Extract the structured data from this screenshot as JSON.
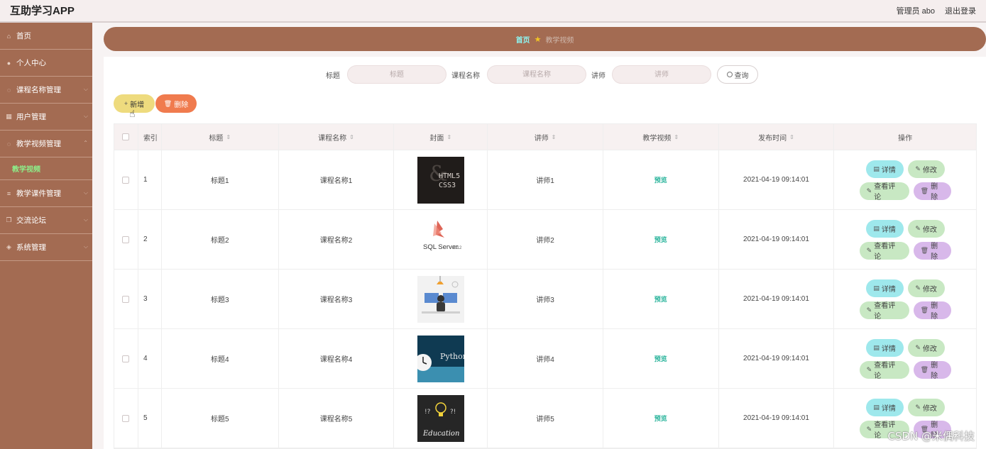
{
  "app": {
    "title": "互助学习APP",
    "admin": "管理员 abo",
    "logout": "退出登录"
  },
  "sidebar": {
    "items": [
      {
        "label": "首页",
        "icon": "home-icon"
      },
      {
        "label": "个人中心",
        "icon": "user-icon"
      },
      {
        "label": "课程名称管理",
        "icon": "grid-icon"
      },
      {
        "label": "用户管理",
        "icon": "grid-icon"
      },
      {
        "label": "教学视频管理",
        "icon": "grid-icon"
      },
      {
        "label": "教学课件管理",
        "icon": "list-icon"
      },
      {
        "label": "交流论坛",
        "icon": "copy-icon"
      },
      {
        "label": "系统管理",
        "icon": "tag-icon"
      }
    ],
    "active_sub": "教学视频"
  },
  "breadcrumb": {
    "home": "首页",
    "current": "教学视频"
  },
  "search": {
    "title_label": "标题",
    "title_placeholder": "标题",
    "course_label": "课程名称",
    "course_placeholder": "课程名称",
    "teacher_label": "讲师",
    "teacher_placeholder": "讲师",
    "query_button": "查询"
  },
  "toolbar": {
    "add_label": "新增",
    "delete_label": "删除"
  },
  "table": {
    "headers": {
      "index": "索引",
      "title": "标题",
      "course": "课程名称",
      "cover": "封面",
      "teacher": "讲师",
      "video": "教学视频",
      "time": "发布时间",
      "ops": "操作"
    },
    "rows": [
      {
        "index": "1",
        "title": "标题1",
        "course": "课程名称1",
        "cover": "html5-css3-cover",
        "teacher": "讲师1",
        "video": "预览",
        "time": "2021-04-19 09:14:01"
      },
      {
        "index": "2",
        "title": "标题2",
        "course": "课程名称2",
        "cover": "sql-server-cover",
        "teacher": "讲师2",
        "video": "预览",
        "time": "2021-04-19 09:14:01"
      },
      {
        "index": "3",
        "title": "标题3",
        "course": "课程名称3",
        "cover": "desk-illustration-cover",
        "teacher": "讲师3",
        "video": "预览",
        "time": "2021-04-19 09:14:01"
      },
      {
        "index": "4",
        "title": "标题4",
        "course": "课程名称4",
        "cover": "python-cover",
        "teacher": "讲师4",
        "video": "预览",
        "time": "2021-04-19 09:14:01"
      },
      {
        "index": "5",
        "title": "标题5",
        "course": "课程名称5",
        "cover": "education-cover",
        "teacher": "讲师5",
        "video": "预览",
        "time": "2021-04-19 09:14:01"
      }
    ],
    "op_labels": {
      "detail": "详情",
      "edit": "修改",
      "review": "查看评论",
      "remove": "删除"
    }
  },
  "cover_text": {
    "html5": "HTML5",
    "css3": "CSS3",
    "sql": "SQL Server",
    "sql_year": "2012",
    "python": "Python",
    "education": "Education"
  },
  "watermark": "CSDN @米偶科技",
  "colors": {
    "sidebar": "#a36b52",
    "active_sub": "#8df08a",
    "add": "#eedb7e",
    "delete": "#f07b4e",
    "detail": "#9ee8ec",
    "edit": "#c8e8c3",
    "remove": "#d8b8ea"
  }
}
